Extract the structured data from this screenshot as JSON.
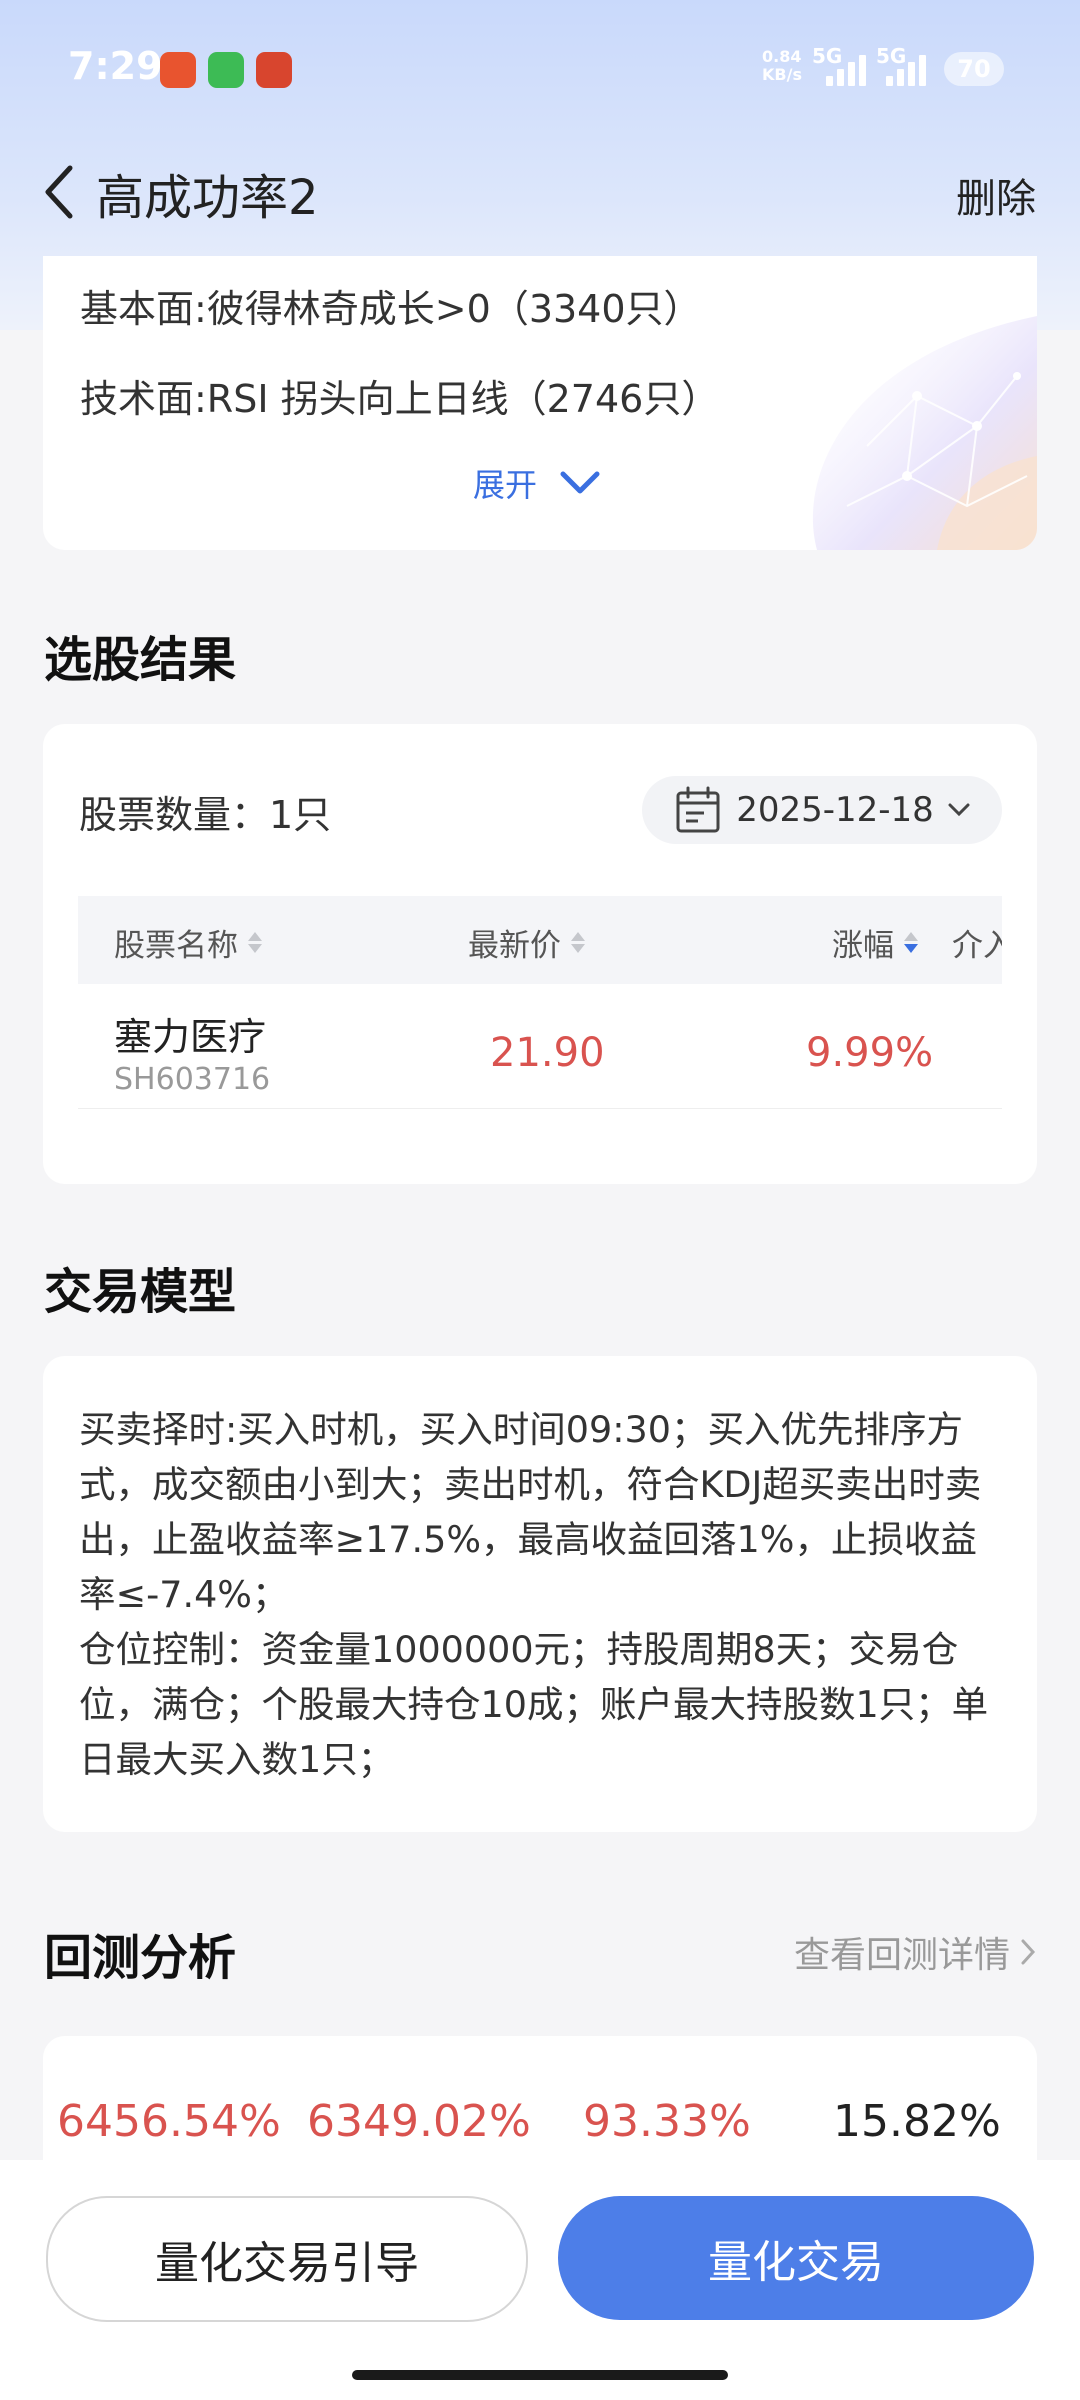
{
  "status_bar": {
    "time": "7:29",
    "net_speed": "0.84",
    "net_unit": "KB/s",
    "sim1": "5G",
    "sim2": "5G",
    "battery": "70"
  },
  "header": {
    "title": "高成功率2",
    "delete_label": "删除"
  },
  "conditions": {
    "lines": [
      "基本面:彼得林奇成长>0（3340只）",
      "技术面:RSI 拐头向上日线（2746只）"
    ],
    "expand_label": "展开"
  },
  "results": {
    "section_title": "选股结果",
    "count_label": "股票数量：1只",
    "date": "2025-12-18",
    "columns": [
      "股票名称",
      "最新价",
      "涨幅",
      "介入"
    ],
    "rows": [
      {
        "name": "塞力医疗",
        "code": "SH603716",
        "price": "21.90",
        "change": "9.99%"
      }
    ]
  },
  "model": {
    "section_title": "交易模型",
    "text_line1": "买卖择时:买入时机，买入时间09:30；买入优先排序方式，成交额由小到大；卖出时机，符合KDJ超买卖出时卖出，止盈收益率≥17.5%，最高收益回落1%，止损收益率≤-7.4%；",
    "text_line2": "仓位控制：资金量1000000元；持股周期8天；交易仓位，满仓；个股最大持仓10成；账户最大持股数1只；单日最大买入数1只；"
  },
  "backtest": {
    "section_title": "回测分析",
    "detail_link": "查看回测详情",
    "values": [
      "6456.54%",
      "6349.02%",
      "93.33%",
      "15.82%"
    ]
  },
  "bottom": {
    "guide_label": "量化交易引导",
    "trade_label": "量化交易"
  },
  "colors": {
    "accent": "#4d7ee8",
    "up_red": "#d9534f"
  }
}
